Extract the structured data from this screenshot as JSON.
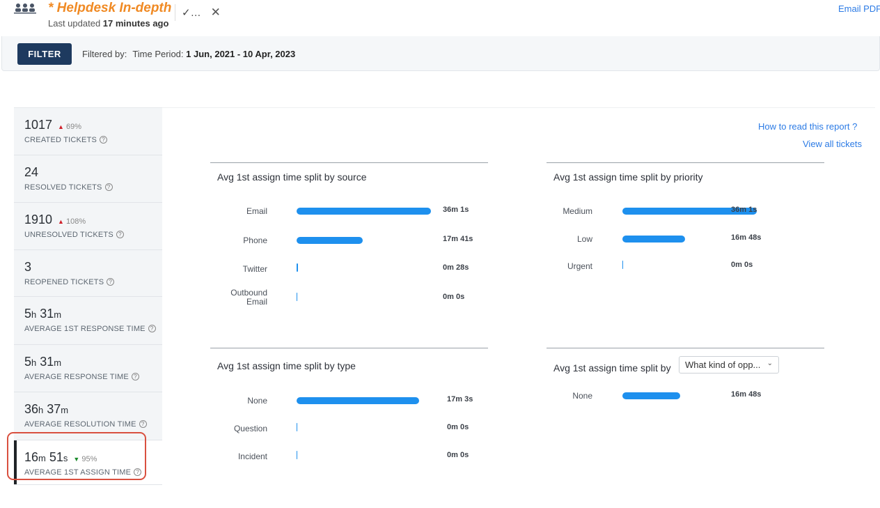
{
  "header": {
    "title": "* Helpdesk In-depth",
    "updated_prefix": "Last updated ",
    "updated_value": "17 minutes ago",
    "email_pdf": "Email PDF"
  },
  "filterbar": {
    "button": "FILTER",
    "filtered_by": "Filtered by:",
    "key": "Time Period:",
    "value": "1 Jun, 2021 - 10 Apr, 2023"
  },
  "metrics": [
    {
      "value": "1017",
      "change": "69%",
      "trend": "up",
      "label": "CREATED TICKETS"
    },
    {
      "value": "24",
      "label": "RESOLVED TICKETS"
    },
    {
      "value": "1910",
      "change": "108%",
      "trend": "up",
      "label": "UNRESOLVED TICKETS"
    },
    {
      "value": "3",
      "label": "REOPENED TICKETS"
    },
    {
      "value_parts": [
        "5",
        "h",
        " 31",
        "m"
      ],
      "label": "AVERAGE 1ST RESPONSE TIME"
    },
    {
      "value_parts": [
        "5",
        "h",
        " 31",
        "m"
      ],
      "label": "AVERAGE RESPONSE TIME"
    },
    {
      "value_parts": [
        "36",
        "h",
        " 37",
        "m"
      ],
      "label": "AVERAGE RESOLUTION TIME"
    },
    {
      "value_parts": [
        "16",
        "m",
        " 51",
        "s"
      ],
      "change": "95%",
      "trend": "down",
      "label": "AVERAGE 1ST ASSIGN TIME",
      "active": true
    }
  ],
  "links": {
    "how_to": "How to read this report ?",
    "view_all": "View all tickets"
  },
  "cards": [
    {
      "title": "Avg 1st assign time split by source",
      "rows": [
        {
          "label": "Email",
          "value": "36m 1s",
          "seconds": 2161
        },
        {
          "label": "Phone",
          "value": "17m 41s",
          "seconds": 1061
        },
        {
          "label": "Twitter",
          "value": "0m 28s",
          "seconds": 28
        },
        {
          "label": "Outbound Email",
          "value": "0m 0s",
          "seconds": 0
        }
      ]
    },
    {
      "title": "Avg 1st assign time split by priority",
      "rows": [
        {
          "label": "Medium",
          "value": "36m 1s",
          "seconds": 2161
        },
        {
          "label": "Low",
          "value": "16m 48s",
          "seconds": 1008
        },
        {
          "label": "Urgent",
          "value": "0m 0s",
          "seconds": 0
        }
      ]
    },
    {
      "title": "Avg 1st assign time split by type",
      "rows": [
        {
          "label": "None",
          "value": "17m 3s",
          "seconds": 1023
        },
        {
          "label": "Question",
          "value": "0m 0s",
          "seconds": 0
        },
        {
          "label": "Incident",
          "value": "0m 0s",
          "seconds": 0
        }
      ]
    },
    {
      "title": "Avg 1st assign time split by",
      "dropdown": "What kind of opp...",
      "rows": [
        {
          "label": "None",
          "value": "16m 48s",
          "seconds": 1008
        }
      ]
    }
  ],
  "colors": {
    "accent_title": "#f08a24",
    "bar": "#1e90ee",
    "filter_button": "#1e3a5f",
    "trend_up": "#d0202a",
    "trend_down": "#1a8a2b",
    "highlight": "#d9503f"
  },
  "icons": [
    "team-icon",
    "check-more-icon",
    "close-icon",
    "info-icon",
    "chevron-down-icon"
  ]
}
